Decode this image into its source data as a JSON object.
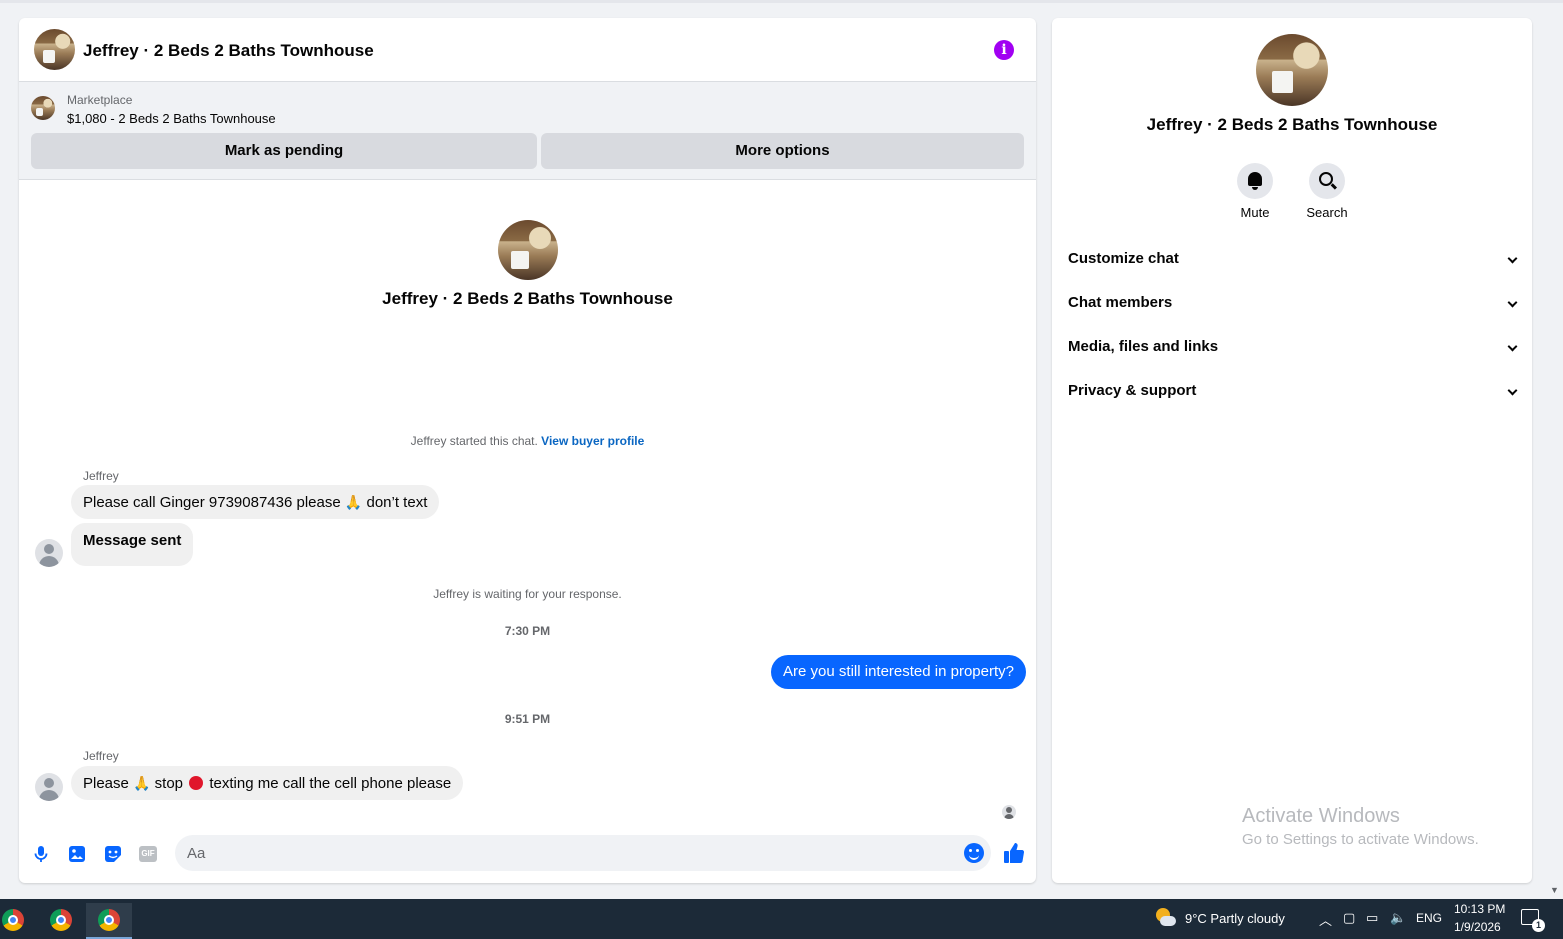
{
  "chat": {
    "title": "Jeffrey · 2 Beds 2 Baths Townhouse",
    "info_icon": "info-icon",
    "marketplace": {
      "label": "Marketplace",
      "listing": "$1,080 - 2 Beds 2 Baths Townhouse",
      "mark_pending_label": "Mark as pending",
      "more_options_label": "More options"
    },
    "profile_name": "Jeffrey · 2 Beds 2 Baths Townhouse",
    "started_text": "Jeffrey started this chat.",
    "view_buyer_profile": "View buyer profile",
    "messages": [
      {
        "sender": "Jeffrey",
        "text_before": "Please call Ginger 9739087436 please",
        "emoji": "🙏",
        "text_after": "don’t text"
      },
      {
        "sender": "",
        "text": "Message sent"
      },
      {
        "status": "Jeffrey is waiting for your response."
      },
      {
        "time": "7:30 PM"
      },
      {
        "outgoing": true,
        "text": "Are you still interested in property?"
      },
      {
        "time": "9:51 PM"
      },
      {
        "sender": "Jeffrey",
        "text_a": "Please",
        "emoji_a": "🙏",
        "text_b": "stop",
        "text_c": "texting me call the cell phone please"
      }
    ],
    "composer": {
      "placeholder": "Aa",
      "gif_label": "GIF",
      "icons": [
        "microphone-icon",
        "image-icon",
        "sticker-icon",
        "gif-icon",
        "emoji-icon",
        "thumbs-up-icon"
      ]
    }
  },
  "sidebar": {
    "title": "Jeffrey · 2 Beds 2 Baths Townhouse",
    "mute_label": "Mute",
    "search_label": "Search",
    "sections": [
      "Customize chat",
      "Chat members",
      "Media, files and links",
      "Privacy & support"
    ],
    "watermark_title": "Activate Windows",
    "watermark_sub": "Go to Settings to activate Windows."
  },
  "taskbar": {
    "weather": "9°C  Partly cloudy",
    "language": "ENG",
    "time": "10:13 PM",
    "date": "1/9/2026",
    "notification_count": "1"
  },
  "colors": {
    "accent": "#0866ff",
    "info": "#a100f2",
    "link": "#0a66c2",
    "taskbar": "#1c2a38"
  }
}
